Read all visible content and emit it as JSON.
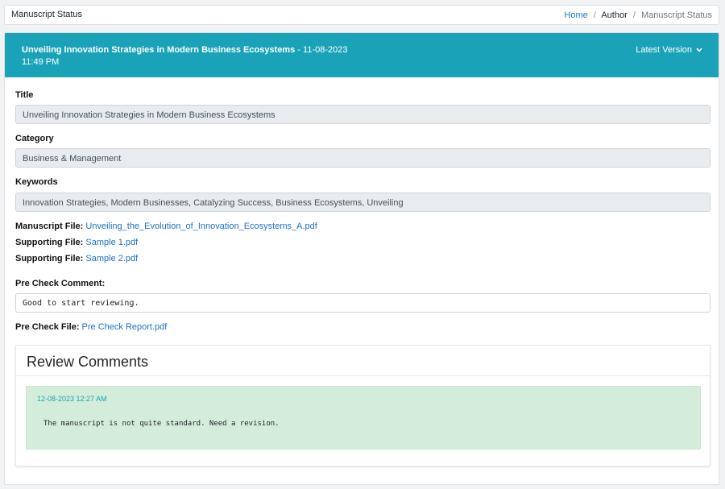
{
  "header": {
    "page_title": "Manuscript Status",
    "breadcrumb": {
      "home": "Home",
      "author": "Author",
      "current": "Manuscript Status",
      "separator": "/"
    }
  },
  "manuscript": {
    "heading_title": "Unveiling Innovation Strategies in Modern Business Ecosystems",
    "heading_datetime": " - 11-08-2023 11:49 PM",
    "version_label": "Latest Version",
    "fields": {
      "title_label": "Title",
      "title_value": "Unveiling Innovation Strategies in Modern Business Ecosystems",
      "category_label": "Category",
      "category_value": "Business & Management",
      "keywords_label": "Keywords",
      "keywords_value": "Innovation Strategies, Modern Businesses, Catalyzing Success, Business Ecosystems, Unveiling"
    },
    "files": {
      "manuscript_label": "Manuscript File:",
      "manuscript_link": "Unveiling_the_Evolution_of_Innovation_Ecosystems_A.pdf",
      "supporting_label": "Supporting File:",
      "supporting_link_1": "Sample 1.pdf",
      "supporting_link_2": "Sample 2.pdf"
    },
    "precheck": {
      "comment_label": "Pre Check Comment:",
      "comment_value": "Good to start reviewing.",
      "file_label": "Pre Check File:",
      "file_link": "Pre Check Report.pdf"
    }
  },
  "review": {
    "heading": "Review Comments",
    "items": [
      {
        "date": "12-08-2023 12:27 AM",
        "text": "The manuscript is not quite standard. Need a revision."
      }
    ]
  },
  "colors": {
    "accent": "#1aa3b8",
    "link": "#1a73c9",
    "review_bg": "#d4edda"
  },
  "icons": {
    "version_toggle": "chevron-down-icon"
  }
}
